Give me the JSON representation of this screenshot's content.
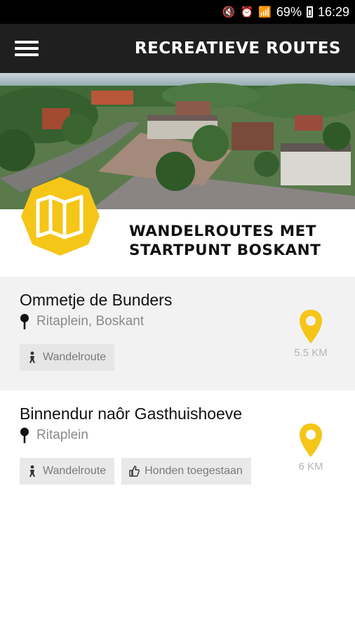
{
  "status_bar": {
    "battery": "69%",
    "time": "16:29"
  },
  "app_bar": {
    "title": "RECREATIEVE ROUTES"
  },
  "section": {
    "title": "WANDELROUTES MET STARTPUNT BOSKANT"
  },
  "colors": {
    "accent": "#f5c518",
    "app_bar": "#1f1f1f"
  },
  "routes": [
    {
      "name": "Ommetje de Bunders",
      "location": "Ritaplein, Boskant",
      "distance": "5.5 KM",
      "tags": [
        {
          "icon": "walker-icon",
          "label": "Wandelroute"
        }
      ]
    },
    {
      "name": "Binnendur naôr Gasthuishoeve",
      "location": "Ritaplein",
      "distance": "6 KM",
      "tags": [
        {
          "icon": "walker-icon",
          "label": "Wandelroute"
        },
        {
          "icon": "thumbs-up-icon",
          "label": "Honden toegestaan"
        }
      ]
    }
  ]
}
